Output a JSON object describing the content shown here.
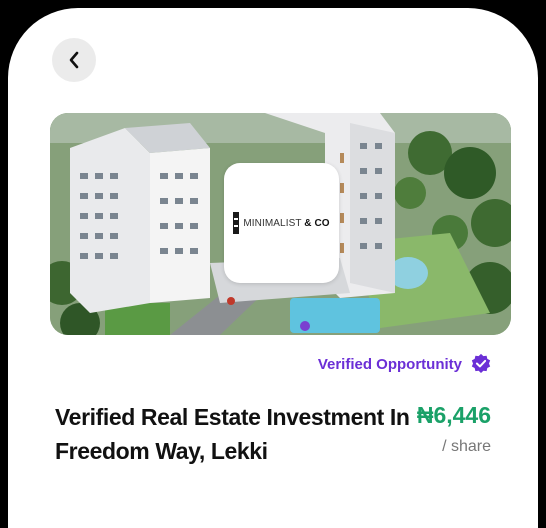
{
  "listing": {
    "logo": {
      "brand": "MINIMALIST",
      "suffix": "& CO"
    },
    "verified_label": "Verified Opportunity",
    "title": "Verified Real Estate Investment In Freedom Way, Lekki",
    "price": "₦6,446",
    "price_unit": "/ share"
  },
  "colors": {
    "accent_purple": "#6b2fd6",
    "price_green": "#1aa168"
  },
  "icons": {
    "back": "chevron-left-icon",
    "verified": "verified-badge-icon"
  }
}
